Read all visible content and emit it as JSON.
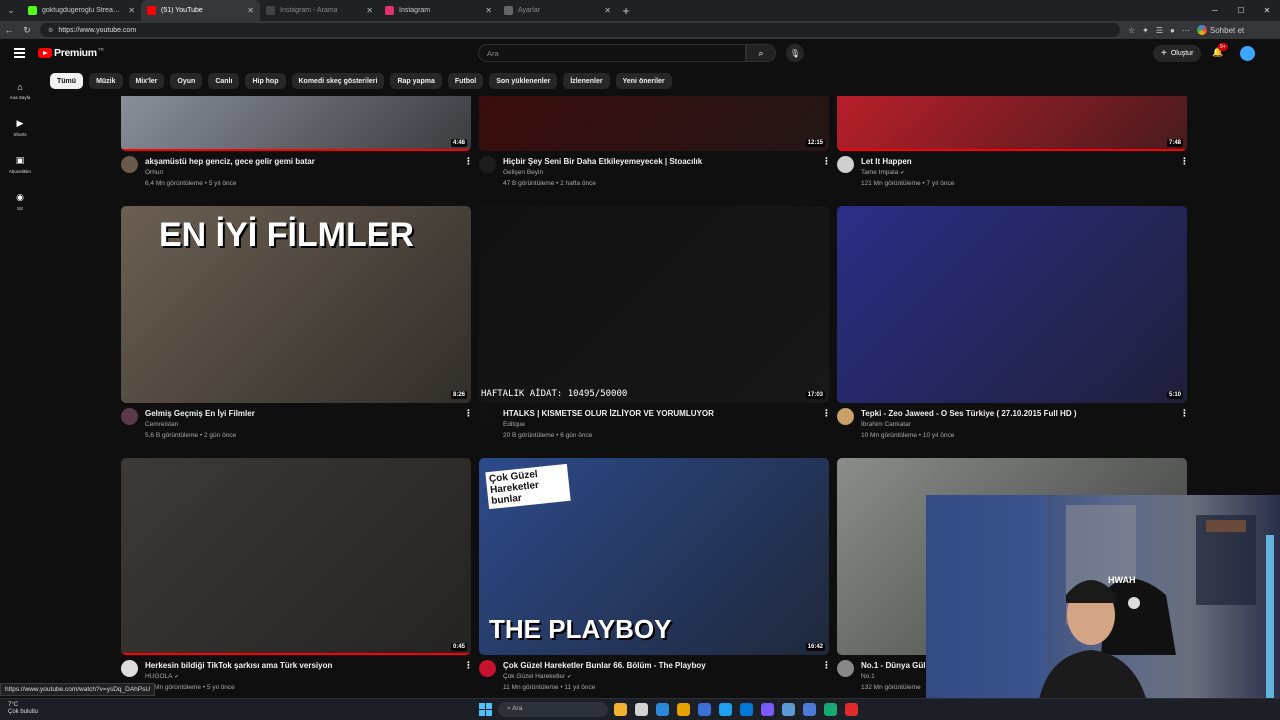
{
  "browser": {
    "tabs": [
      {
        "label": "goktugdugeroglu Stream - Watch",
        "active": false,
        "icon": "kick-icon",
        "color": "#53fc18"
      },
      {
        "label": "(51) YouTube",
        "active": true,
        "icon": "youtube-icon",
        "color": "#ff0000"
      },
      {
        "label": "Instagram - Arama",
        "active": false,
        "icon": "instagram-icon",
        "color": "#444444"
      },
      {
        "label": "Instagram",
        "active": false,
        "icon": "instagram-icon",
        "color": "#e1306c"
      },
      {
        "label": "Ayarlar",
        "active": false,
        "icon": "gear-icon",
        "color": "#666666"
      }
    ],
    "url": "https://www.youtube.com",
    "chat_button": "Sohbet et",
    "status_url": "https://www.youtube.com/watch?v=ysDq_DAhPsU"
  },
  "youtube": {
    "logo": "Premium",
    "logo_cc": "TR",
    "search_placeholder": "Ara",
    "create_label": "Oluştur",
    "notif_badge": "9+",
    "guide": [
      {
        "label": "Ana Sayfa",
        "icon": "home-icon"
      },
      {
        "label": "Shorts",
        "icon": "shorts-icon"
      },
      {
        "label": "Abonelikler",
        "icon": "subscriptions-icon"
      },
      {
        "label": "Siz",
        "icon": "you-icon"
      }
    ],
    "chips": [
      "Tümü",
      "Müzik",
      "Mix'ler",
      "Oyun",
      "Canlı",
      "Hip hop",
      "Komedi skeç gösterileri",
      "Rap yapma",
      "Futbol",
      "Son yüklenenler",
      "İzlenenler",
      "Yeni öneriler"
    ],
    "videos": [
      {
        "title": "akşamüstü hep genciz, gece gelir gemi batar",
        "channel": "Orhun",
        "meta": "6,4 Mn görüntüleme • 5 yıl önce",
        "duration": "4:48",
        "verified": false,
        "progress": 1.0,
        "avatar": "#6a5a4a",
        "thumb": "#8a8f9a"
      },
      {
        "title": "Hiçbir Şey Seni Bir Daha Etkileyemeyecek | Stoacılık",
        "channel": "Gelişen Beyin",
        "meta": "47 B görüntüleme • 2 hafta önce",
        "duration": "12:15",
        "verified": false,
        "progress": 0,
        "avatar": "#1d1d1d",
        "thumb": "#3a0c0c"
      },
      {
        "title": "Let It Happen",
        "channel": "Tame Impala",
        "meta": "121 Mn görüntüleme • 7 yıl önce",
        "duration": "7:48",
        "verified": true,
        "progress": 1.0,
        "avatar": "#cfcfcf",
        "thumb": "#b81e2a"
      },
      {
        "title": "Gelmiş Geçmiş En İyi Filmler",
        "channel": "Cemreistan",
        "meta": "5,6 B görüntüleme • 2 gün önce",
        "duration": "8:26",
        "verified": false,
        "progress": 0,
        "avatar": "#5a3a4a",
        "thumb": "#6b5f52",
        "overlay": "EN İYİ FİLMLER"
      },
      {
        "title": "HTALKS | KISMETSE OLUR İZLİYOR VE YORUMLUYOR",
        "channel": "Editque",
        "meta": "20 B görüntüleme • 6 gün önce",
        "duration": "17:03",
        "verified": false,
        "progress": 0,
        "avatar": "#111111",
        "thumb": "#121212",
        "overlay": "HAFTALIK AİDAT: 10495/50000"
      },
      {
        "title": "Tepki - Zeo Jaweed - O Ses Türkiye ( 27.10.2015 Full HD )",
        "channel": "İbrahim Cankatar",
        "meta": "10 Mn görüntüleme • 10 yıl önce",
        "duration": "5:10",
        "verified": false,
        "progress": 0,
        "avatar": "#c9a06a",
        "thumb": "#2b2e86"
      },
      {
        "title": "Herkesin bildiği TikTok şarkısı ama Türk versiyon",
        "channel": "HUGOLA",
        "meta": "54 Mn görüntüleme • 5 yıl önce",
        "duration": "0:45",
        "verified": true,
        "progress": 1.0,
        "avatar": "#dddddd",
        "thumb": "#3c3a36"
      },
      {
        "title": "Çok Güzel Hareketler Bunlar 66. Bölüm - The Playboy",
        "channel": "Çok Güzel Hareketler",
        "meta": "11 Mn görüntüleme • 11 yıl önce",
        "duration": "16:42",
        "verified": true,
        "progress": 0,
        "avatar": "#c4122f",
        "thumb": "#2d4a8a",
        "overlay": "THE PLAYBOY",
        "logo_text": "Çok Güzel Hareketler bunlar"
      },
      {
        "title": "No.1 - Dünya Gül E",
        "channel": "No.1",
        "meta": "132 Mn görüntüleme",
        "duration": "",
        "verified": false,
        "progress": 0,
        "avatar": "#888888",
        "thumb": "#8a8d8a"
      }
    ]
  },
  "taskbar": {
    "weather_temp": "7°C",
    "weather_desc": "Çok bulutlu",
    "search_placeholder": "Ara",
    "apps": [
      "#f2b233",
      "#d3d3d3",
      "#2b88d8",
      "#e8a200",
      "#3d6fd8",
      "#1da1f2",
      "#0078d4",
      "#7a5af8",
      "#5a9bd5",
      "#4f7bd8",
      "#19a974",
      "#e02b2b"
    ]
  }
}
